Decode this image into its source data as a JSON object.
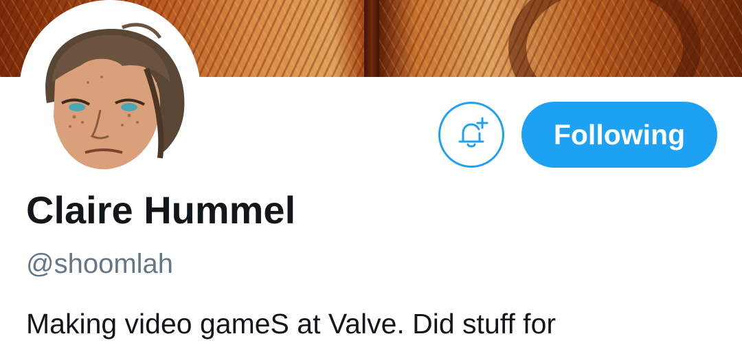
{
  "header": {
    "banner_image": "canyon-illustration-banner"
  },
  "profile": {
    "avatar": "user-avatar-illustration",
    "display_name": "Claire Hummel",
    "handle": "@shoomlah",
    "bio": "Making video gameS at Valve. Did stuff for"
  },
  "actions": {
    "notifications_icon": "bell-plus-icon",
    "following_label": "Following"
  },
  "colors": {
    "accent": "#1da1f2",
    "text_primary": "#14171a",
    "text_secondary": "#657786",
    "background": "#ffffff"
  }
}
